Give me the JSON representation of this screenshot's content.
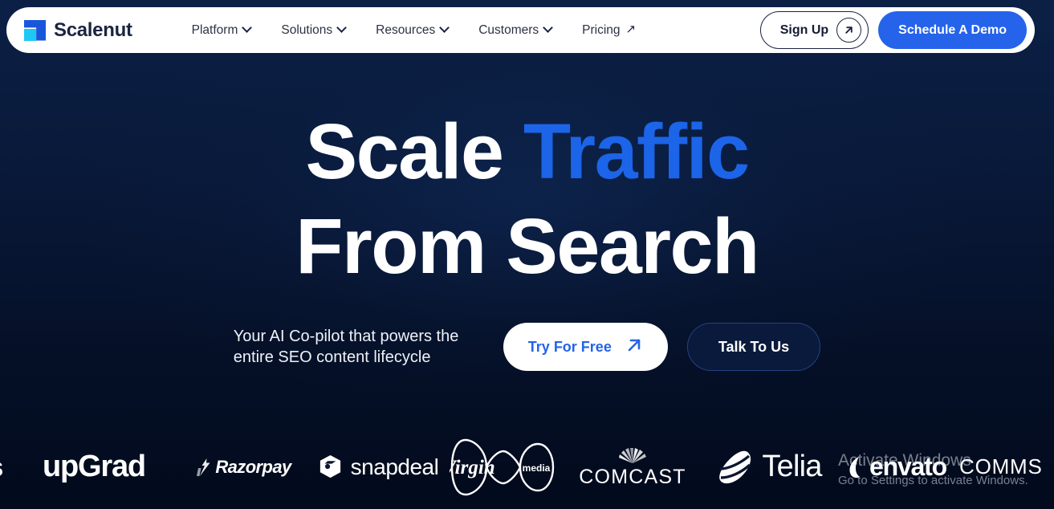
{
  "brand": {
    "name": "Scalenut",
    "logo_icon": "scalenut-logo-icon",
    "mark_color": "#1a56db",
    "accent_color": "#1ec8f5"
  },
  "nav": {
    "items": [
      {
        "label": "Platform",
        "icon": "chevron-down-icon"
      },
      {
        "label": "Solutions",
        "icon": "chevron-down-icon"
      },
      {
        "label": "Resources",
        "icon": "chevron-down-icon"
      },
      {
        "label": "Customers",
        "icon": "chevron-down-icon"
      },
      {
        "label": "Pricing",
        "icon": "arrow-up-right-icon"
      }
    ],
    "sign_up": {
      "label": "Sign Up",
      "icon": "arrow-up-right-circle-icon"
    },
    "demo": {
      "label": "Schedule A Demo",
      "color": "#2563eb"
    }
  },
  "hero": {
    "headline_line1_white": "Scale",
    "headline_line1_accent": "Traffic",
    "headline_line2": "From Search",
    "accent_color": "#1c64e8",
    "subcopy": "Your AI Co-pilot that powers the entire SEO content lifecycle",
    "cta_primary": {
      "label": "Try For Free",
      "icon": "arrow-up-right-icon"
    },
    "cta_secondary": {
      "label": "Talk To Us"
    }
  },
  "clients": {
    "cut_off_left": "s",
    "logos": [
      {
        "name": "upgrad-logo",
        "text": "upGrad"
      },
      {
        "name": "razorpay-logo",
        "text": "Razorpay"
      },
      {
        "name": "snapdeal-logo",
        "text": "snapdeal"
      },
      {
        "name": "virgin-media-logo",
        "text": "Virgin",
        "sub": "media"
      },
      {
        "name": "comcast-logo",
        "text": "COMCAST"
      },
      {
        "name": "telia-logo",
        "text": "Telia"
      },
      {
        "name": "envato-logo",
        "text": "envato"
      },
      {
        "name": "comms-logo",
        "text": "COMMS"
      }
    ]
  },
  "watermark": {
    "title": "Activate Windows",
    "subtitle": "Go to Settings to activate Windows."
  }
}
